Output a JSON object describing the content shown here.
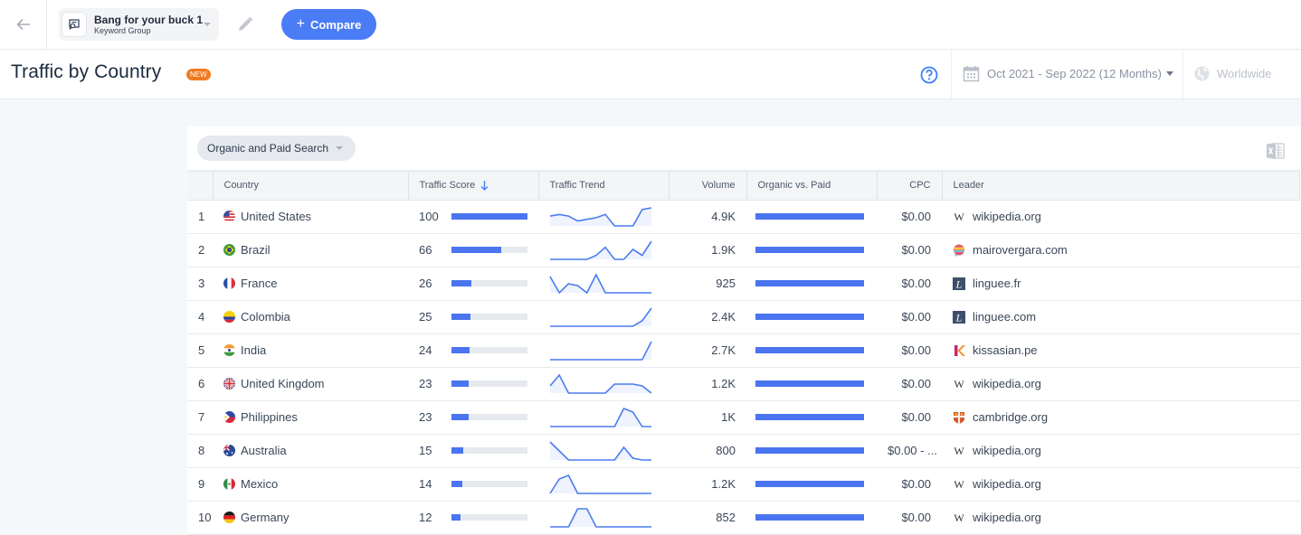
{
  "topbar": {
    "back_icon": "arrow-left-icon",
    "group": {
      "title": "Bang for your buck 1",
      "subtitle": "Keyword Group",
      "icon": "keyword-group-icon"
    },
    "edit_icon": "pencil-icon",
    "compare_label": "Compare",
    "compare_icon": "plus-icon"
  },
  "header": {
    "title": "Traffic by Country",
    "badge": "NEW",
    "help_icon": "question-circle-icon",
    "date_range": "Oct 2021 - Sep 2022 (12 Months)",
    "date_icon": "calendar-icon",
    "geo": "Worldwide",
    "geo_icon": "globe-icon"
  },
  "card": {
    "filter_label": "Organic and Paid Search",
    "export_icon": "excel-export-icon",
    "columns": [
      "",
      "Country",
      "Traffic Score",
      "Traffic Trend",
      "Volume",
      "Organic vs. Paid",
      "CPC",
      "Leader"
    ],
    "sort_column": "Traffic Score",
    "sort_direction": "desc",
    "colors": {
      "accent": "#4a74f0",
      "bar_track": "#e6e9ee"
    },
    "rows": [
      {
        "rank": "1",
        "country": "United States",
        "flag": "us",
        "score": "100",
        "score_value": 100,
        "trend": [
          6,
          7,
          6,
          3,
          4,
          5,
          7,
          0,
          0,
          0,
          10,
          11
        ],
        "volume": "4.9K",
        "organic_share": 1.0,
        "cpc": "$0.00",
        "leader": "wikipedia.org",
        "leader_icon": "wikipedia"
      },
      {
        "rank": "2",
        "country": "Brazil",
        "flag": "br",
        "score": "66",
        "score_value": 66,
        "trend": [
          0,
          0,
          0,
          0,
          0,
          2,
          6,
          0,
          0,
          5,
          2,
          9
        ],
        "volume": "1.9K",
        "organic_share": 1.0,
        "cpc": "$0.00",
        "leader": "mairovergara.com",
        "leader_icon": "mairovergara"
      },
      {
        "rank": "3",
        "country": "France",
        "flag": "fr",
        "score": "26",
        "score_value": 26,
        "trend": [
          9,
          0,
          5,
          4,
          0,
          10,
          0,
          0,
          0,
          0,
          0,
          0
        ],
        "volume": "925",
        "organic_share": 1.0,
        "cpc": "$0.00",
        "leader": "linguee.fr",
        "leader_icon": "linguee"
      },
      {
        "rank": "4",
        "country": "Colombia",
        "flag": "co",
        "score": "25",
        "score_value": 25,
        "trend": [
          0,
          0,
          0,
          0,
          0,
          0,
          0,
          0,
          0,
          0,
          3,
          10
        ],
        "volume": "2.4K",
        "organic_share": 1.0,
        "cpc": "$0.00",
        "leader": "linguee.com",
        "leader_icon": "linguee"
      },
      {
        "rank": "5",
        "country": "India",
        "flag": "in",
        "score": "24",
        "score_value": 24,
        "trend": [
          0,
          0,
          0,
          0,
          0,
          0,
          0,
          0,
          0,
          0,
          0,
          10
        ],
        "volume": "2.7K",
        "organic_share": 1.0,
        "cpc": "$0.00",
        "leader": "kissasian.pe",
        "leader_icon": "kissasian"
      },
      {
        "rank": "6",
        "country": "United Kingdom",
        "flag": "gb",
        "score": "23",
        "score_value": 23,
        "trend": [
          4,
          10,
          0,
          0,
          0,
          0,
          0,
          5,
          5,
          5,
          4,
          0
        ],
        "volume": "1.2K",
        "organic_share": 1.0,
        "cpc": "$0.00",
        "leader": "wikipedia.org",
        "leader_icon": "wikipedia"
      },
      {
        "rank": "7",
        "country": "Philippines",
        "flag": "ph",
        "score": "23",
        "score_value": 23,
        "trend": [
          0,
          0,
          0,
          0,
          0,
          0,
          0,
          0,
          10,
          8,
          0,
          0
        ],
        "volume": "1K",
        "organic_share": 1.0,
        "cpc": "$0.00",
        "leader": "cambridge.org",
        "leader_icon": "cambridge"
      },
      {
        "rank": "8",
        "country": "Australia",
        "flag": "au",
        "score": "15",
        "score_value": 15,
        "trend": [
          10,
          5,
          0,
          0,
          0,
          0,
          0,
          0,
          7,
          1,
          0,
          0
        ],
        "volume": "800",
        "organic_share": 1.0,
        "cpc": "$0.00 - ...",
        "leader": "wikipedia.org",
        "leader_icon": "wikipedia"
      },
      {
        "rank": "9",
        "country": "Mexico",
        "flag": "mx",
        "score": "14",
        "score_value": 14,
        "trend": [
          0,
          8,
          10,
          0,
          0,
          0,
          0,
          0,
          0,
          0,
          0,
          0
        ],
        "volume": "1.2K",
        "organic_share": 1.0,
        "cpc": "$0.00",
        "leader": "wikipedia.org",
        "leader_icon": "wikipedia"
      },
      {
        "rank": "10",
        "country": "Germany",
        "flag": "de",
        "score": "12",
        "score_value": 12,
        "trend": [
          0,
          0,
          0,
          10,
          10,
          0,
          0,
          0,
          0,
          0,
          0,
          0
        ],
        "volume": "852",
        "organic_share": 1.0,
        "cpc": "$0.00",
        "leader": "wikipedia.org",
        "leader_icon": "wikipedia"
      }
    ]
  }
}
